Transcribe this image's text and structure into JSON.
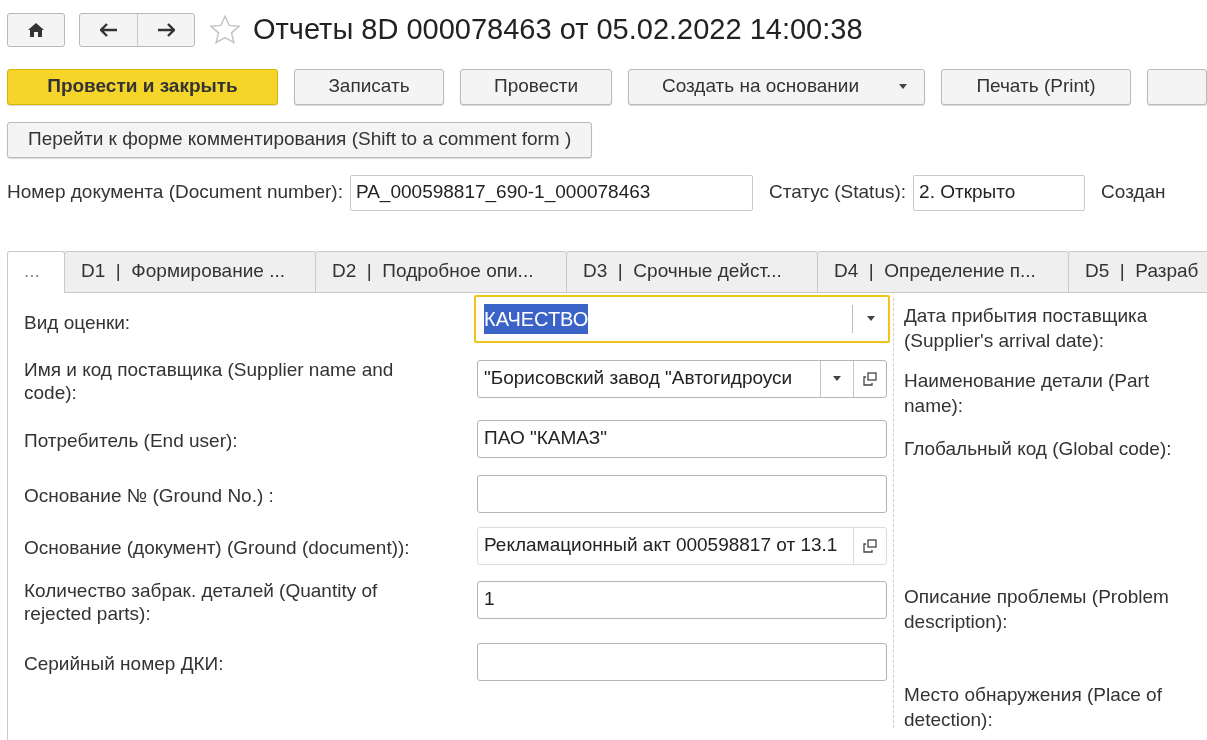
{
  "window": {
    "title": "Отчеты 8D 000078463 от 05.02.2022 14:00:38",
    "favorite": false
  },
  "toolbar": {
    "buttons": [
      {
        "label": "Провести и закрыть",
        "kind": "primary"
      },
      {
        "label": "Записать",
        "kind": "default"
      },
      {
        "label": "Провести",
        "kind": "default"
      },
      {
        "label": "Создать на основании",
        "kind": "dropdown"
      },
      {
        "label": "Печать (Print)",
        "kind": "default"
      },
      {
        "kind": "partial"
      }
    ]
  },
  "comment_button": {
    "label": "Перейти к форме комментирования (Shift to a comment form )"
  },
  "header_fields": [
    {
      "label": "Номер документа (Document number):",
      "value": "PA_000598817_690-1_000078463"
    },
    {
      "label": "Статус (Status):",
      "value": "2. Открыто"
    }
  ],
  "header_trailing_label": "Создан",
  "tabs": [
    {
      "label": "...",
      "selected": true
    },
    {
      "label": "D1  |  Формирование ...",
      "selected": false
    },
    {
      "label": "D2  |  Подробное опи...",
      "selected": false
    },
    {
      "label": "D3  |  Срочные дейст...",
      "selected": false
    },
    {
      "label": "D4  |  Определение п...",
      "selected": false
    },
    {
      "label": "D5  |  Разраб",
      "selected": false
    }
  ],
  "form": {
    "left": [
      {
        "label": "Вид оценки:",
        "kind": "select",
        "value": "КАЧЕСТВО",
        "focused": true,
        "value_selected": true
      },
      {
        "label": "Имя и код поставщика (Supplier name and code):",
        "kind": "lookup",
        "value": "\"Борисовский завод \"Автогидроуси",
        "focused": false,
        "value_selected": false
      },
      {
        "label": "Потребитель (End user):",
        "kind": "text",
        "value": "ПАО \"КАМАЗ\"",
        "focused": false,
        "value_selected": false
      },
      {
        "label": "Основание № (Ground No.)    :",
        "kind": "text",
        "focused": false
      },
      {
        "label": "Основание (документ) (Ground (document)):",
        "kind": "link",
        "value": "Рекламационный акт 000598817 от 13.1",
        "focused": false,
        "value_selected": false
      },
      {
        "label": "Количество забрак. деталей (Quantity of rejected parts):",
        "kind": "text",
        "value": "1",
        "focused": false,
        "value_selected": false
      },
      {
        "label": "Серийный номер ДКИ:",
        "kind": "text",
        "focused": false
      }
    ],
    "right": [
      {
        "label": "Дата прибытия поставщика (Supplier's arrival date):"
      },
      {
        "label": "Наименование детали (Part name):"
      },
      {
        "label": "Глобальный код (Global code):"
      },
      {
        "label": "Описание проблемы (Problem description):"
      },
      {
        "label": "Место обнаружения (Place of detection):"
      }
    ]
  }
}
